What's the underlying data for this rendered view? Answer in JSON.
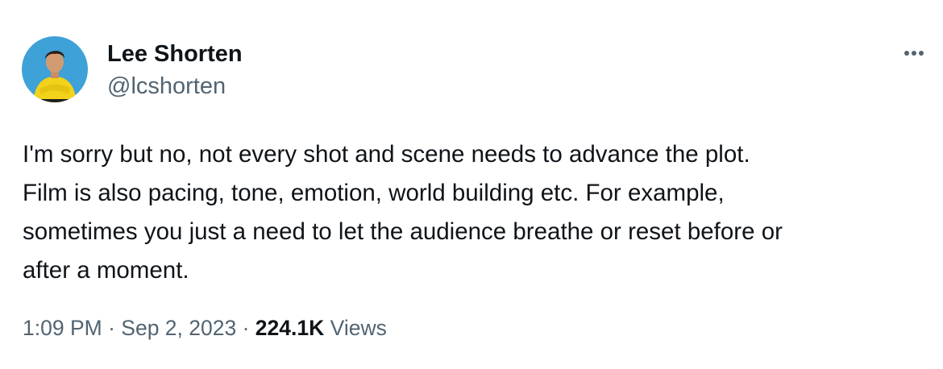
{
  "author": {
    "display_name": "Lee Shorten",
    "handle": "@lcshorten",
    "avatar_bg": "#3ea1d8",
    "avatar_shirt": "#f2d21a"
  },
  "menu": {
    "icon": "more-horizontal-icon"
  },
  "tweet": {
    "lines": [
      "I'm sorry but no, not every shot and scene needs to advance the plot.",
      "Film is also pacing, tone, emotion, world building etc. For example,",
      "sometimes you just a need to let the audience breathe or reset before or",
      "after a moment."
    ]
  },
  "meta": {
    "time": "1:09 PM",
    "separator": "·",
    "date": "Sep 2, 2023",
    "views_count": "224.1K",
    "views_label": "Views"
  },
  "colors": {
    "text_primary": "#0f1419",
    "text_secondary": "#536471"
  }
}
